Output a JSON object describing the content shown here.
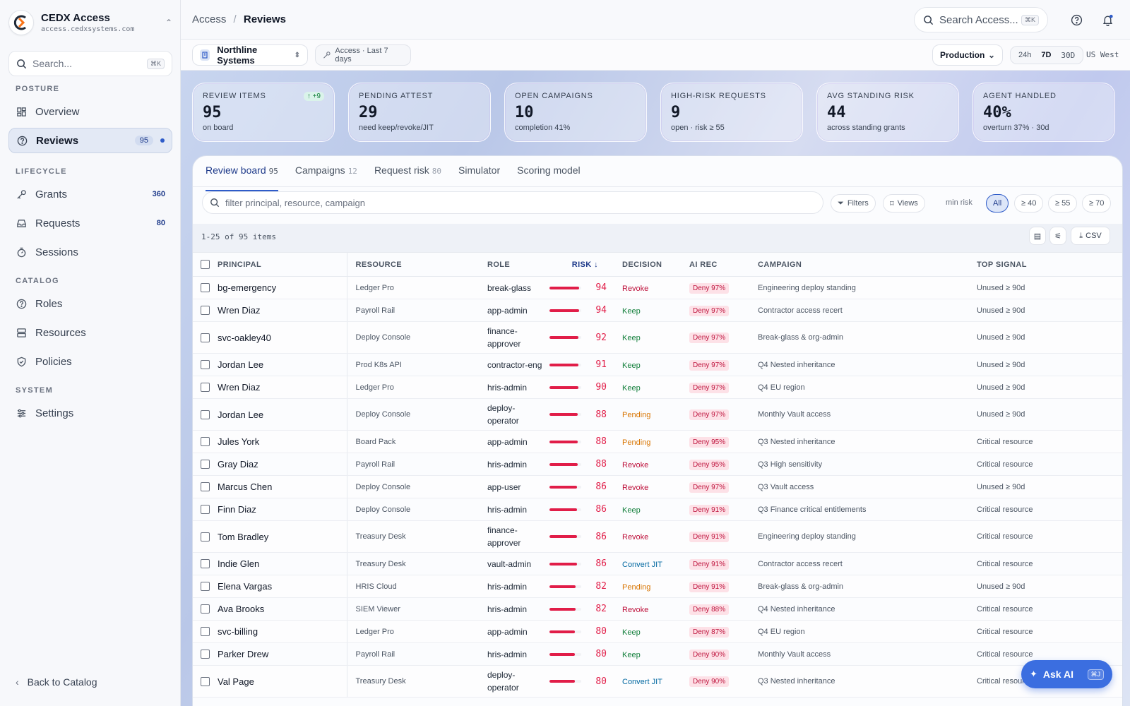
{
  "org": {
    "name": "CEDX Access",
    "url": "access.cedxsystems.com"
  },
  "sidebar": {
    "search_placeholder": "Search...",
    "search_kbd": "⌘K",
    "sections": {
      "posture": "POSTURE",
      "lifecycle": "LIFECYCLE",
      "catalog": "CATALOG",
      "system": "SYSTEM"
    },
    "items": {
      "overview": {
        "label": "Overview"
      },
      "reviews": {
        "label": "Reviews",
        "count": "95"
      },
      "grants": {
        "label": "Grants",
        "count": "360"
      },
      "requests": {
        "label": "Requests",
        "count": "80"
      },
      "sessions": {
        "label": "Sessions"
      },
      "roles": {
        "label": "Roles"
      },
      "resources": {
        "label": "Resources"
      },
      "policies": {
        "label": "Policies"
      },
      "settings": {
        "label": "Settings"
      }
    },
    "back_label": "Back to Catalog"
  },
  "topbar": {
    "breadcrumb_parent": "Access",
    "breadcrumb_sep": "/",
    "breadcrumb_current": "Reviews",
    "search_placeholder": "Search Access...",
    "search_kbd": "⌘K"
  },
  "filterbar": {
    "tenant": "Northline Systems",
    "scope": "Access · Last 7 days",
    "environment": "Production",
    "ranges": [
      "24h",
      "7D",
      "30D"
    ],
    "active_range": "7D",
    "region": "US West"
  },
  "kpis": [
    {
      "title": "REVIEW ITEMS",
      "value": "95",
      "sub": "on board",
      "delta": "↑ +9"
    },
    {
      "title": "PENDING ATTEST",
      "value": "29",
      "sub": "need keep/revoke/JIT"
    },
    {
      "title": "OPEN CAMPAIGNS",
      "value": "10",
      "sub": "completion 41%"
    },
    {
      "title": "HIGH-RISK REQUESTS",
      "value": "9",
      "sub": "open · risk ≥ 55"
    },
    {
      "title": "AVG STANDING RISK",
      "value": "44",
      "sub": "across standing grants"
    },
    {
      "title": "AGENT HANDLED",
      "value": "40%",
      "sub": "overturn 37% · 30d"
    }
  ],
  "tabs": [
    {
      "label": "Review board",
      "count": "95"
    },
    {
      "label": "Campaigns",
      "count": "12"
    },
    {
      "label": "Request risk",
      "count": "80"
    },
    {
      "label": "Simulator",
      "count": ""
    },
    {
      "label": "Scoring model",
      "count": ""
    }
  ],
  "board": {
    "filter_placeholder": "filter principal, resource, campaign",
    "filters_label": "Filters",
    "views_label": "Views",
    "minrisk_label": "min risk",
    "risk_chips": [
      "All",
      "≥ 40",
      "≥ 55",
      "≥ 70"
    ],
    "active_chip": "All",
    "count_text": "1-25 of 95 items",
    "csv_label": "CSV"
  },
  "table": {
    "headers": {
      "principal": "PRINCIPAL",
      "resource": "RESOURCE",
      "role": "ROLE",
      "risk": "RISK ↓",
      "decision": "DECISION",
      "ai_rec": "AI REC",
      "campaign": "CAMPAIGN",
      "signal": "TOP SIGNAL"
    },
    "rows": [
      {
        "principal": "bg-emergency",
        "resource": "Ledger Pro",
        "role": "break-glass",
        "risk": 94,
        "decision": "Revoke",
        "ai": "Deny 97%",
        "campaign": "Engineering deploy standing",
        "signal": "Unused ≥ 90d"
      },
      {
        "principal": "Wren Diaz",
        "resource": "Payroll Rail",
        "role": "app-admin",
        "risk": 94,
        "decision": "Keep",
        "ai": "Deny 97%",
        "campaign": "Contractor access recert",
        "signal": "Unused ≥ 90d"
      },
      {
        "principal": "svc-oakley40",
        "resource": "Deploy Console",
        "role": "finance-\napprover",
        "risk": 92,
        "decision": "Keep",
        "ai": "Deny 97%",
        "campaign": "Break-glass & org-admin",
        "signal": "Unused ≥ 90d"
      },
      {
        "principal": "Jordan Lee",
        "resource": "Prod K8s API",
        "role": "contractor-eng",
        "risk": 91,
        "decision": "Keep",
        "ai": "Deny 97%",
        "campaign": "Q4 Nested inheritance",
        "signal": "Unused ≥ 90d"
      },
      {
        "principal": "Wren Diaz",
        "resource": "Ledger Pro",
        "role": "hris-admin",
        "risk": 90,
        "decision": "Keep",
        "ai": "Deny 97%",
        "campaign": "Q4 EU region",
        "signal": "Unused ≥ 90d"
      },
      {
        "principal": "Jordan Lee",
        "resource": "Deploy Console",
        "role": "deploy-\noperator",
        "risk": 88,
        "decision": "Pending",
        "ai": "Deny 97%",
        "campaign": "Monthly Vault access",
        "signal": "Unused ≥ 90d"
      },
      {
        "principal": "Jules York",
        "resource": "Board Pack",
        "role": "app-admin",
        "risk": 88,
        "decision": "Pending",
        "ai": "Deny 95%",
        "campaign": "Q3 Nested inheritance",
        "signal": "Critical resource"
      },
      {
        "principal": "Gray Diaz",
        "resource": "Payroll Rail",
        "role": "hris-admin",
        "risk": 88,
        "decision": "Revoke",
        "ai": "Deny 95%",
        "campaign": "Q3 High sensitivity",
        "signal": "Critical resource"
      },
      {
        "principal": "Marcus Chen",
        "resource": "Deploy Console",
        "role": "app-user",
        "risk": 86,
        "decision": "Revoke",
        "ai": "Deny 97%",
        "campaign": "Q3 Vault access",
        "signal": "Unused ≥ 90d"
      },
      {
        "principal": "Finn Diaz",
        "resource": "Deploy Console",
        "role": "hris-admin",
        "risk": 86,
        "decision": "Keep",
        "ai": "Deny 91%",
        "campaign": "Q3 Finance critical entitlements",
        "signal": "Critical resource"
      },
      {
        "principal": "Tom Bradley",
        "resource": "Treasury Desk",
        "role": "finance-\napprover",
        "risk": 86,
        "decision": "Revoke",
        "ai": "Deny 91%",
        "campaign": "Engineering deploy standing",
        "signal": "Critical resource"
      },
      {
        "principal": "Indie Glen",
        "resource": "Treasury Desk",
        "role": "vault-admin",
        "risk": 86,
        "decision": "Convert JIT",
        "ai": "Deny 91%",
        "campaign": "Contractor access recert",
        "signal": "Critical resource"
      },
      {
        "principal": "Elena Vargas",
        "resource": "HRIS Cloud",
        "role": "hris-admin",
        "risk": 82,
        "decision": "Pending",
        "ai": "Deny 91%",
        "campaign": "Break-glass & org-admin",
        "signal": "Unused ≥ 90d"
      },
      {
        "principal": "Ava Brooks",
        "resource": "SIEM Viewer",
        "role": "hris-admin",
        "risk": 82,
        "decision": "Revoke",
        "ai": "Deny 88%",
        "campaign": "Q4 Nested inheritance",
        "signal": "Critical resource"
      },
      {
        "principal": "svc-billing",
        "resource": "Ledger Pro",
        "role": "app-admin",
        "risk": 80,
        "decision": "Keep",
        "ai": "Deny 87%",
        "campaign": "Q4 EU region",
        "signal": "Critical resource"
      },
      {
        "principal": "Parker Drew",
        "resource": "Payroll Rail",
        "role": "hris-admin",
        "risk": 80,
        "decision": "Keep",
        "ai": "Deny 90%",
        "campaign": "Monthly Vault access",
        "signal": "Critical resource"
      },
      {
        "principal": "Val Page",
        "resource": "Treasury Desk",
        "role": "deploy-\noperator",
        "risk": 80,
        "decision": "Convert JIT",
        "ai": "Deny 90%",
        "campaign": "Q3 Nested inheritance",
        "signal": "Critical resource"
      }
    ]
  },
  "ask_ai": {
    "label": "Ask AI",
    "kbd": "⌘J"
  },
  "colors": {
    "accent": "#2f5cc9",
    "risk": "#e11d48",
    "revoke": "#be123c",
    "keep": "#15803d",
    "pending": "#d97706",
    "convert": "#0369a1"
  }
}
